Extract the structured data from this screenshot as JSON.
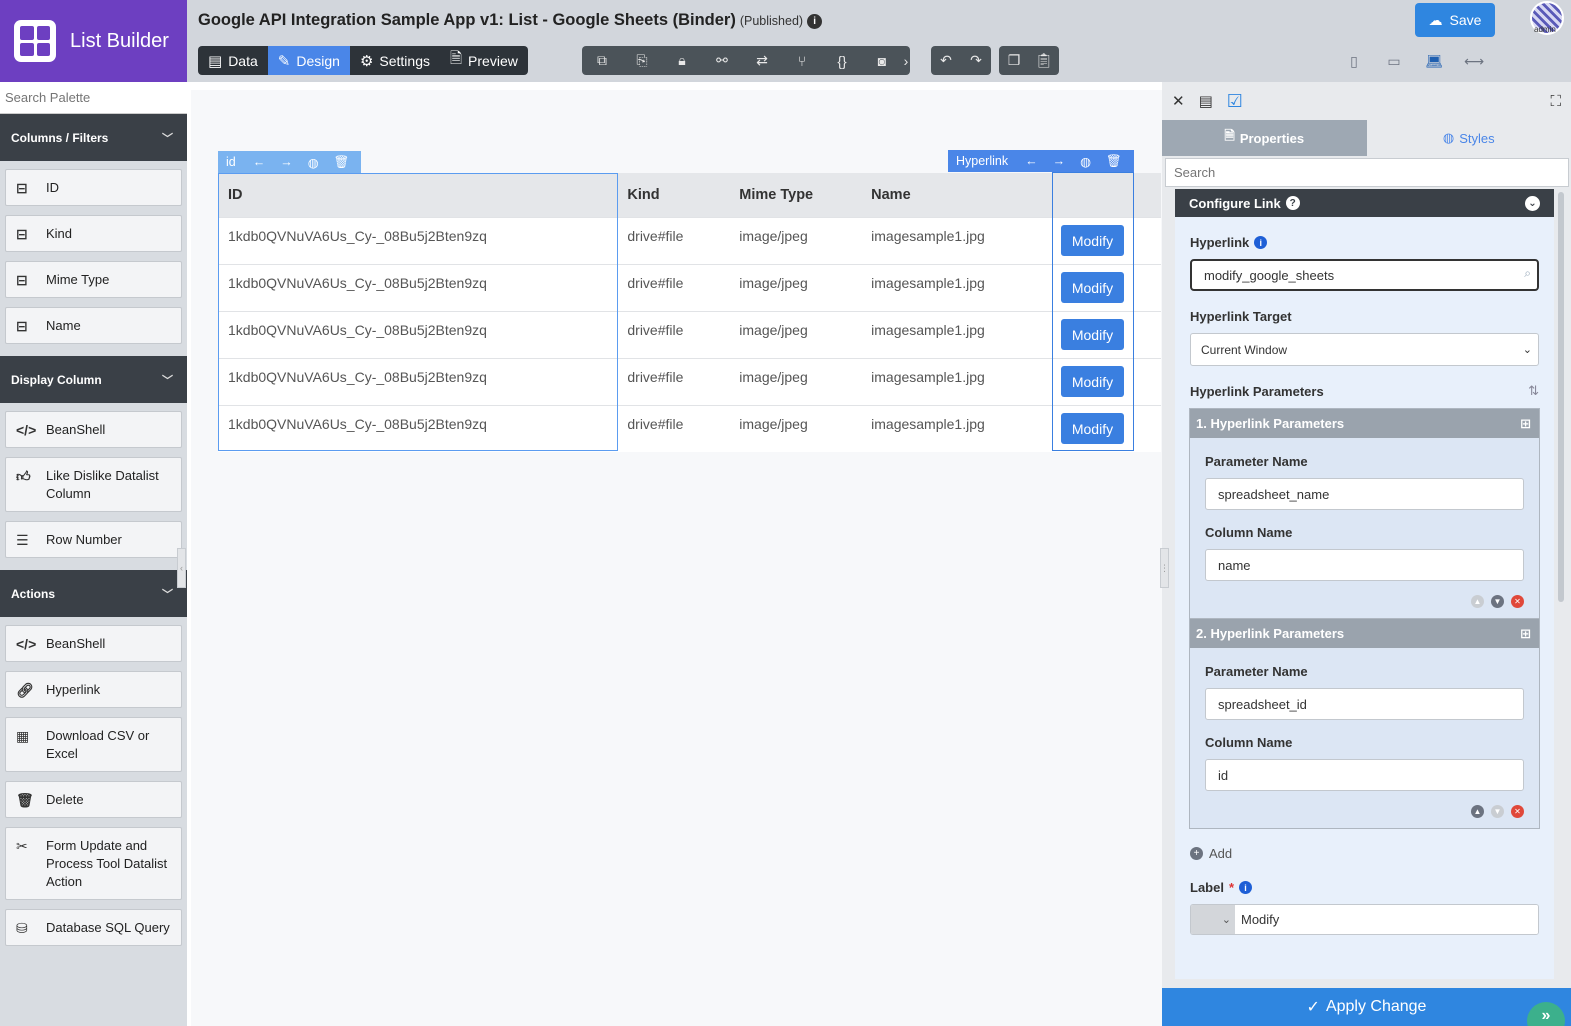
{
  "app": {
    "name": "List Builder"
  },
  "header": {
    "title": "Google API Integration Sample App v1: List - Google Sheets (Binder)",
    "status": "(Published)",
    "tabs": [
      {
        "label": "Data",
        "icon": "data-icon"
      },
      {
        "label": "Design",
        "icon": "design-icon",
        "active": true
      },
      {
        "label": "Settings",
        "icon": "gear-icon"
      },
      {
        "label": "Preview",
        "icon": "preview-icon"
      }
    ],
    "save_label": "Save",
    "avatar_label": "admin"
  },
  "palette": {
    "search_placeholder": "Search Palette",
    "sections": [
      {
        "title": "Columns / Filters",
        "items": [
          {
            "label": "ID",
            "icon": "drive-icon"
          },
          {
            "label": "Kind",
            "icon": "drive-icon"
          },
          {
            "label": "Mime Type",
            "icon": "drive-icon"
          },
          {
            "label": "Name",
            "icon": "drive-icon"
          }
        ]
      },
      {
        "title": "Display Column",
        "items": [
          {
            "label": "BeanShell",
            "icon": "code-icon"
          },
          {
            "label": "Like Dislike Datalist Column",
            "icon": "thumbs-up-icon"
          },
          {
            "label": "Row Number",
            "icon": "list-icon"
          }
        ]
      },
      {
        "title": "Actions",
        "items": [
          {
            "label": "BeanShell",
            "icon": "code-icon"
          },
          {
            "label": "Hyperlink",
            "icon": "link-icon"
          },
          {
            "label": "Download CSV or Excel",
            "icon": "grid-icon"
          },
          {
            "label": "Delete",
            "icon": "trash-icon"
          },
          {
            "label": "Form Update and Process Tool Datalist Action",
            "icon": "tools-icon"
          },
          {
            "label": "Database SQL Query",
            "icon": "database-icon"
          }
        ]
      }
    ]
  },
  "canvas": {
    "id_toolbar_label": "id",
    "hyperlink_toolbar_label": "Hyperlink",
    "columns": [
      "ID",
      "Kind",
      "Mime Type",
      "Name",
      ""
    ],
    "rows": [
      [
        "1kdb0QVNuVA6Us_Cy-_08Bu5j2Bten9zq",
        "drive#file",
        "image/jpeg",
        "imagesample1.jpg"
      ],
      [
        "1kdb0QVNuVA6Us_Cy-_08Bu5j2Bten9zq",
        "drive#file",
        "image/jpeg",
        "imagesample1.jpg"
      ],
      [
        "1kdb0QVNuVA6Us_Cy-_08Bu5j2Bten9zq",
        "drive#file",
        "image/jpeg",
        "imagesample1.jpg"
      ],
      [
        "1kdb0QVNuVA6Us_Cy-_08Bu5j2Bten9zq",
        "drive#file",
        "image/jpeg",
        "imagesample1.jpg"
      ],
      [
        "1kdb0QVNuVA6Us_Cy-_08Bu5j2Bten9zq",
        "drive#file",
        "image/jpeg",
        "imagesample1.jpg"
      ]
    ],
    "action_label": "Modify"
  },
  "panel": {
    "tabs": {
      "properties": "Properties",
      "styles": "Styles"
    },
    "search_placeholder": "Search",
    "section_title": "Configure Link",
    "hyperlink_label": "Hyperlink",
    "hyperlink_value": "modify_google_sheets",
    "target_label": "Hyperlink Target",
    "target_value": "Current Window",
    "params_label": "Hyperlink Parameters",
    "params": [
      {
        "title": "1. Hyperlink Parameters",
        "param_label": "Parameter Name",
        "param_value": "spreadsheet_name",
        "column_label": "Column Name",
        "column_value": "name"
      },
      {
        "title": "2. Hyperlink Parameters",
        "param_label": "Parameter Name",
        "param_value": "spreadsheet_id",
        "column_label": "Column Name",
        "column_value": "id"
      }
    ],
    "add_label": "Add",
    "label_label": "Label",
    "label_required": "*",
    "label_value": "Modify",
    "apply_label": "Apply Change"
  },
  "colors": {
    "brand": "#6d3fc1",
    "accent": "#4a86e8",
    "dark": "#3a4047"
  }
}
